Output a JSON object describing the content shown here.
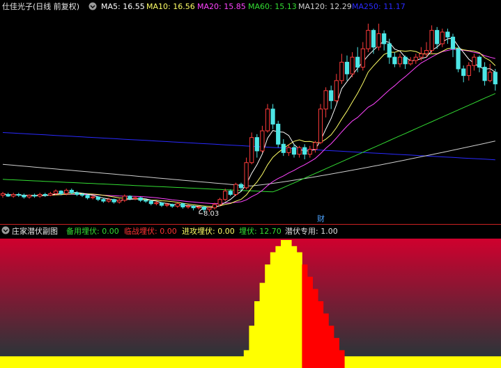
{
  "colors": {
    "background": "#000000",
    "up": "#ff3b3b",
    "down": "#4de6e6",
    "ma5": "#ffffff",
    "ma10": "#ffff66",
    "ma20": "#ff44ff",
    "ma60": "#33dd33",
    "ma120": "#cfcfcf",
    "ma250": "#2a2aff",
    "grad_top": "#d0002e",
    "grad_bottom": "#1a3a3a",
    "yellow_fill": "#ffff00",
    "red_fill": "#ff0000",
    "divider": "#cc2222"
  },
  "main_panel": {
    "stock_label": "仕佳光子(日线 前复权)",
    "dropdown_icon": "chevron-down-icon",
    "ma_legend": [
      {
        "key": "ma5",
        "label": "MA5: 16.55"
      },
      {
        "key": "ma10",
        "label": "MA10: 16.56"
      },
      {
        "key": "ma20",
        "label": "MA20: 15.85"
      },
      {
        "key": "ma60",
        "label": "MA60: 15.13"
      },
      {
        "key": "ma120",
        "label": "MA120: 12.29"
      },
      {
        "key": "ma250",
        "label": "MA250: 11.17"
      }
    ],
    "low_marker": "8.03",
    "event_marker": "财"
  },
  "sub_panel": {
    "title": "庄家潜伏副图",
    "indicators": [
      {
        "label": "备用埋伏: 0.00",
        "color": "#33dd33"
      },
      {
        "label": "临战埋伏: 0.00",
        "color": "#ff3333"
      },
      {
        "label": "进攻埋伏: 0.00",
        "color": "#ffff66"
      },
      {
        "label": "埋伏: 12.70",
        "color": "#33dd33"
      },
      {
        "label": "潜伏专用: 1.00",
        "color": "#e0e0e0"
      }
    ]
  },
  "chart_data": {
    "type": "candlestick",
    "y_range": [
      7.5,
      19.8
    ],
    "low_value": 8.03,
    "candles": [
      [
        9.05,
        9.15,
        8.9,
        9.25
      ],
      [
        9.1,
        9.0,
        8.95,
        9.2
      ],
      [
        9.0,
        9.1,
        8.9,
        9.2
      ],
      [
        9.1,
        9.05,
        8.95,
        9.2
      ],
      [
        9.05,
        8.95,
        8.85,
        9.15
      ],
      [
        8.95,
        9.05,
        8.85,
        9.1
      ],
      [
        9.05,
        9.0,
        8.9,
        9.15
      ],
      [
        9.0,
        9.1,
        8.9,
        9.2
      ],
      [
        9.1,
        9.05,
        8.95,
        9.2
      ],
      [
        9.05,
        9.15,
        9.0,
        9.25
      ],
      [
        9.15,
        9.3,
        9.05,
        9.4
      ],
      [
        9.3,
        9.15,
        9.05,
        9.35
      ],
      [
        9.15,
        9.35,
        9.05,
        9.45
      ],
      [
        9.35,
        9.2,
        9.1,
        9.45
      ],
      [
        9.2,
        9.1,
        9.0,
        9.3
      ],
      [
        9.1,
        9.05,
        8.95,
        9.2
      ],
      [
        9.05,
        8.9,
        8.8,
        9.1
      ],
      [
        8.9,
        8.95,
        8.8,
        9.05
      ],
      [
        8.95,
        8.8,
        8.7,
        9.0
      ],
      [
        8.8,
        8.7,
        8.6,
        8.9
      ],
      [
        8.7,
        8.8,
        8.6,
        8.9
      ],
      [
        8.8,
        8.65,
        8.55,
        8.85
      ],
      [
        8.65,
        8.75,
        8.55,
        8.85
      ],
      [
        8.75,
        9.0,
        8.65,
        9.1
      ],
      [
        9.0,
        8.85,
        8.75,
        9.05
      ],
      [
        8.85,
        8.9,
        8.75,
        9.0
      ],
      [
        8.9,
        8.75,
        8.65,
        8.95
      ],
      [
        8.75,
        8.7,
        8.6,
        8.85
      ],
      [
        8.7,
        8.55,
        8.45,
        8.75
      ],
      [
        8.55,
        8.6,
        8.45,
        8.7
      ],
      [
        8.6,
        8.45,
        8.35,
        8.65
      ],
      [
        8.45,
        8.5,
        8.35,
        8.6
      ],
      [
        8.5,
        8.4,
        8.3,
        8.55
      ],
      [
        8.4,
        8.55,
        8.3,
        8.6
      ],
      [
        8.55,
        8.35,
        8.25,
        8.6
      ],
      [
        8.35,
        8.4,
        8.25,
        8.5
      ],
      [
        8.4,
        8.3,
        8.15,
        8.45
      ],
      [
        8.3,
        8.35,
        8.2,
        8.4
      ],
      [
        8.35,
        8.2,
        8.03,
        8.4
      ],
      [
        8.2,
        8.3,
        8.05,
        8.35
      ],
      [
        8.3,
        8.5,
        8.2,
        8.6
      ],
      [
        8.5,
        8.8,
        8.4,
        8.9
      ],
      [
        8.8,
        9.3,
        8.7,
        9.45
      ],
      [
        9.3,
        9.1,
        9.0,
        9.4
      ],
      [
        9.1,
        9.7,
        9.0,
        9.8
      ],
      [
        9.7,
        9.5,
        9.3,
        9.8
      ],
      [
        9.5,
        11.0,
        9.4,
        11.3
      ],
      [
        11.0,
        12.5,
        10.9,
        12.8
      ],
      [
        12.5,
        11.7,
        11.3,
        12.7
      ],
      [
        11.7,
        12.9,
        11.6,
        13.2
      ],
      [
        12.9,
        14.2,
        12.8,
        14.5
      ],
      [
        14.2,
        13.3,
        13.0,
        14.5
      ],
      [
        13.3,
        12.1,
        11.9,
        13.5
      ],
      [
        12.1,
        11.6,
        11.4,
        12.4
      ],
      [
        11.6,
        11.9,
        11.4,
        12.1
      ],
      [
        11.9,
        11.5,
        11.3,
        12.1
      ],
      [
        11.5,
        11.9,
        11.3,
        12.0
      ],
      [
        11.9,
        11.5,
        11.2,
        12.1
      ],
      [
        11.5,
        11.8,
        11.3,
        12.0
      ],
      [
        11.8,
        12.2,
        11.6,
        12.3
      ],
      [
        12.2,
        14.2,
        12.1,
        14.5
      ],
      [
        14.2,
        15.3,
        13.7,
        15.5
      ],
      [
        15.3,
        14.7,
        14.2,
        15.6
      ],
      [
        14.7,
        15.9,
        14.6,
        16.3
      ],
      [
        15.9,
        17.0,
        15.7,
        17.5
      ],
      [
        17.0,
        16.3,
        15.9,
        17.4
      ],
      [
        16.3,
        17.3,
        16.1,
        17.6
      ],
      [
        17.3,
        16.7,
        16.4,
        17.9
      ],
      [
        16.7,
        17.8,
        16.5,
        18.2
      ],
      [
        17.8,
        18.9,
        17.6,
        19.3
      ],
      [
        18.9,
        17.9,
        17.5,
        19.0
      ],
      [
        17.9,
        18.7,
        17.7,
        19.3
      ],
      [
        18.7,
        18.1,
        17.7,
        18.9
      ],
      [
        18.1,
        17.3,
        16.9,
        18.4
      ],
      [
        17.3,
        16.9,
        16.7,
        17.6
      ],
      [
        16.9,
        17.3,
        16.7,
        17.5
      ],
      [
        17.3,
        16.9,
        16.6,
        17.4
      ],
      [
        16.9,
        17.1,
        16.8,
        17.3
      ],
      [
        17.1,
        17.3,
        16.9,
        17.5
      ],
      [
        17.3,
        17.5,
        17.1,
        17.9
      ],
      [
        17.5,
        17.7,
        17.3,
        18.2
      ],
      [
        17.7,
        18.9,
        17.5,
        19.2
      ],
      [
        18.9,
        18.1,
        17.8,
        19.1
      ],
      [
        18.1,
        18.8,
        17.9,
        19.0
      ],
      [
        18.8,
        18.5,
        18.1,
        19.0
      ],
      [
        18.5,
        17.8,
        17.3,
        18.7
      ],
      [
        17.8,
        16.6,
        16.4,
        18.0
      ],
      [
        16.6,
        16.2,
        15.8,
        16.8
      ],
      [
        16.2,
        16.8,
        15.9,
        17.0
      ],
      [
        16.8,
        17.3,
        16.5,
        17.5
      ],
      [
        17.3,
        16.7,
        16.4,
        17.4
      ],
      [
        16.7,
        15.9,
        15.6,
        17.0
      ],
      [
        15.9,
        16.4,
        15.8,
        16.9
      ],
      [
        16.4,
        15.7,
        15.3,
        16.6
      ]
    ],
    "ma_tail_values": {
      "ma5": 16.55,
      "ma10": 16.56,
      "ma20": 15.85,
      "ma60": 15.13,
      "ma120": 12.29,
      "ma250": 11.17
    },
    "sub_indicator": {
      "yellow_peak_bars": [
        0,
        0,
        0,
        0,
        0,
        0,
        0,
        0,
        0,
        0,
        0,
        0,
        0,
        0,
        0,
        0,
        0,
        0,
        0,
        0,
        0,
        0,
        0,
        0,
        0,
        0,
        0,
        0,
        0,
        0,
        0,
        0,
        0,
        0,
        0,
        0,
        0,
        0,
        0,
        0,
        0,
        0,
        0,
        0,
        0,
        0,
        2,
        6,
        10,
        13,
        16,
        18,
        19,
        20,
        20,
        19,
        18,
        0,
        0,
        0,
        0,
        0,
        0,
        0,
        0,
        0,
        0,
        0,
        0,
        0,
        0,
        0,
        0,
        0,
        0,
        0,
        0,
        0,
        0,
        0,
        0,
        0,
        0,
        0,
        0,
        0,
        0,
        0,
        0,
        0,
        0,
        0,
        0,
        0
      ],
      "red_peak_bars": [
        0,
        0,
        0,
        0,
        0,
        0,
        0,
        0,
        0,
        0,
        0,
        0,
        0,
        0,
        0,
        0,
        0,
        0,
        0,
        0,
        0,
        0,
        0,
        0,
        0,
        0,
        0,
        0,
        0,
        0,
        0,
        0,
        0,
        0,
        0,
        0,
        0,
        0,
        0,
        0,
        0,
        0,
        0,
        0,
        0,
        0,
        0,
        0,
        0,
        0,
        0,
        0,
        0,
        0,
        0,
        0,
        0,
        16,
        14,
        12,
        10,
        8,
        6,
        4,
        2,
        0,
        0,
        0,
        0,
        0,
        0,
        0,
        0,
        0,
        0,
        0,
        0,
        0,
        0,
        0,
        0,
        0,
        0,
        0,
        0,
        0,
        0,
        0,
        0,
        0,
        0,
        0,
        0,
        0
      ],
      "baseline": 1.0,
      "peak_value": 20
    }
  }
}
